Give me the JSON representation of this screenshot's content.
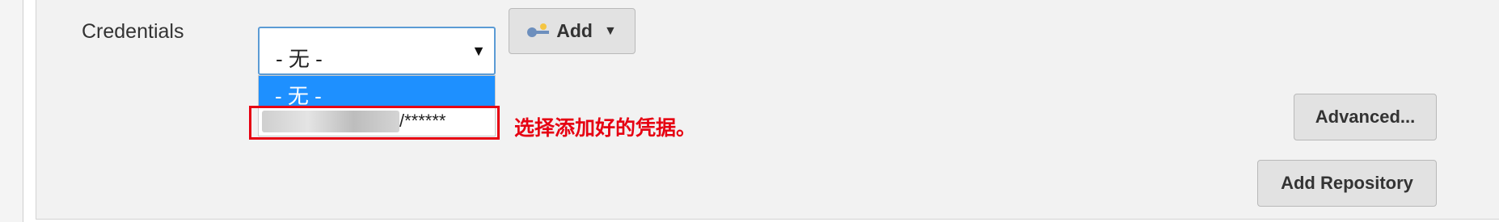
{
  "credentials": {
    "label": "Credentials",
    "select_value": "- 无 -",
    "options": [
      "- 无 -",
      "/******"
    ]
  },
  "buttons": {
    "add": "Add",
    "advanced": "Advanced...",
    "add_repository": "Add Repository"
  },
  "annotation": "选择添加好的凭据。",
  "icons": {
    "key": "key-icon",
    "caret": "caret-down-icon",
    "arrow": "dropdown-arrow-icon"
  },
  "colors": {
    "highlight": "#e60012",
    "selected_option": "#1e90ff"
  }
}
